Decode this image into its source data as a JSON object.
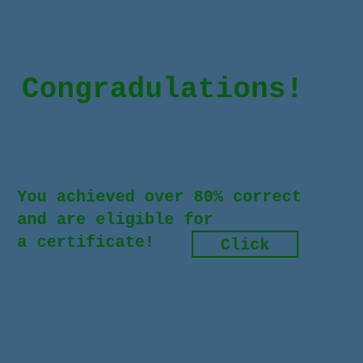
{
  "title": "Congradulations!",
  "message": {
    "line1": "You achieved over 80% correct",
    "line2": "and are eligible for",
    "line3": "a certificate!"
  },
  "button": {
    "label": "Click"
  },
  "colors": {
    "background": "#3e6380",
    "text": "#0a5a12"
  }
}
